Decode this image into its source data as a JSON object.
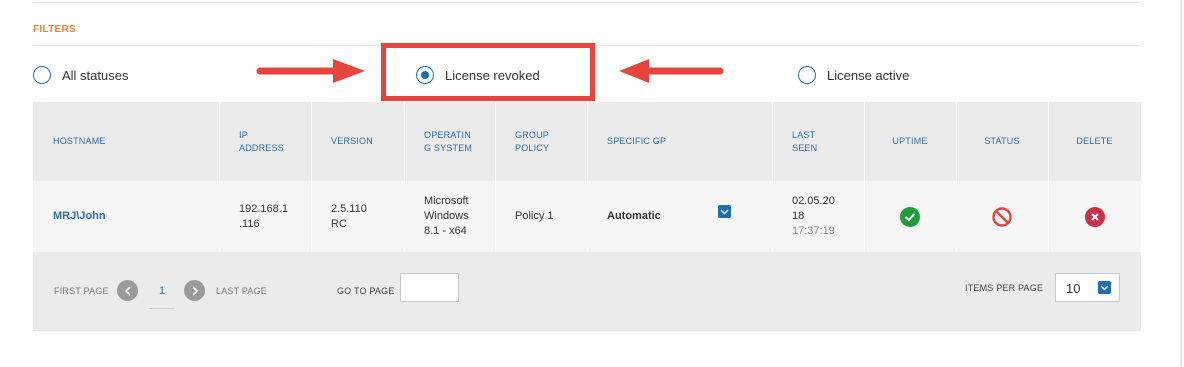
{
  "filters": {
    "title": "FILTERS",
    "options": [
      {
        "label": "All statuses",
        "selected": false
      },
      {
        "label": "License revoked",
        "selected": true
      },
      {
        "label": "License active",
        "selected": false
      }
    ]
  },
  "table": {
    "headers": {
      "hostname": "HOSTNAME",
      "ip_1": "IP",
      "ip_2": "ADDRESS",
      "version": "VERSION",
      "os_1": "OPERATIN",
      "os_2": "G SYSTEM",
      "gp_1": "GROUP",
      "gp_2": "POLICY",
      "specific_gp": "SPECIFIC GP",
      "seen_1": "LAST",
      "seen_2": "SEEN",
      "uptime": "UPTIME",
      "status": "STATUS",
      "delete": "DELETE"
    },
    "row": {
      "hostname": "MRJ\\John",
      "ip_1": "192.168.1",
      "ip_2": ".116",
      "version_1": "2.5.110",
      "version_2": "RC",
      "os_1": "Microsoft",
      "os_2": "Windows",
      "os_3": "8.1 - x64",
      "group_policy": "Policy 1",
      "specific_gp": "Automatic",
      "seen_1": "02.05.20",
      "seen_2": "18",
      "seen_3": "17:37:19",
      "uptime_icon": "check-circle-icon",
      "status_icon": "prohibited-icon",
      "delete_icon": "delete-x-icon"
    }
  },
  "pagination": {
    "first_page": "FIRST PAGE",
    "current_page": "1",
    "last_page": "LAST PAGE",
    "goto_label": "GO TO PAGE",
    "goto_value": "",
    "items_per_page_label": "ITEMS PER PAGE",
    "items_per_page_value": "10"
  },
  "colors": {
    "accent": "#1f6fb0",
    "filters_title": "#e8843a",
    "annotation_red": "#e5453d",
    "uptime_green": "#1e9e3a",
    "status_red": "#e0463f",
    "delete_red": "#c9314a"
  }
}
